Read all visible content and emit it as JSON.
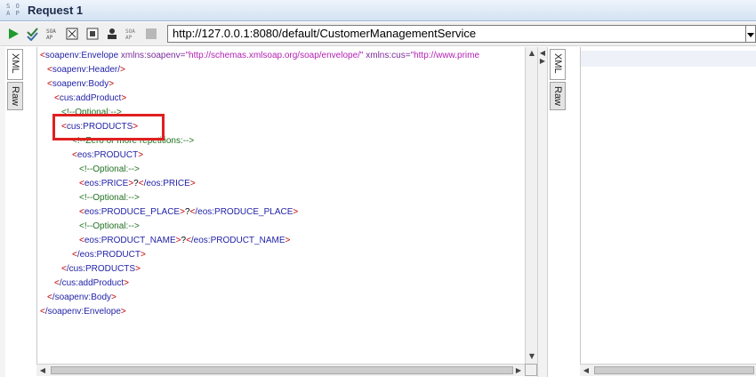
{
  "window": {
    "badge_top": "S O",
    "badge_bottom": "A P",
    "title": "Request 1"
  },
  "toolbar": {
    "url": "http://127.0.0.1:8080/default/CustomerManagementService",
    "icons": [
      "play-icon",
      "check-icon",
      "soap-icon",
      "wsa-icon",
      "stop-icon",
      "user-icon",
      "soap-icon-2",
      "gray-square-icon"
    ]
  },
  "tabs": {
    "xml": "XML",
    "raw": "Raw",
    "right_xml": "XML",
    "right_raw": "Raw"
  },
  "editor": {
    "l1_tag": "soapenv:Envelope",
    "l1_attr1": "xmlns:soapenv=",
    "l1_val1": "\"http://schemas.xmlsoap.org/soap/envelope/\"",
    "l1_attr2": "xmlns:cus=",
    "l1_val2": "\"http://www.prime",
    "l2": "soapenv:Header/",
    "l3": "soapenv:Body",
    "l4": "cus:addProduct",
    "l5": "<!--Optional:-->",
    "l6": "cus:PRODUCTS",
    "l7": "<!--Zero or more repetitions:-->",
    "l8": "eos:PRODUCT",
    "l9": "<!--Optional:-->",
    "l10_tag": "eos:PRICE",
    "l10_text": "?",
    "l10_close": "/eos:PRICE",
    "l11": "<!--Optional:-->",
    "l12_tag": "eos:PRODUCE_PLACE",
    "l12_text": "?",
    "l12_close": "/eos:PRODUCE_PLACE",
    "l13": "<!--Optional:-->",
    "l14_tag": "eos:PRODUCT_NAME",
    "l14_text": "?",
    "l14_close": "/eos:PRODUCT_NAME",
    "l15": "/eos:PRODUCT",
    "l16": "/cus:PRODUCTS",
    "l17": "/cus:addProduct",
    "l18": "/soapenv:Body",
    "l19": "/soapenv:Envelope"
  }
}
